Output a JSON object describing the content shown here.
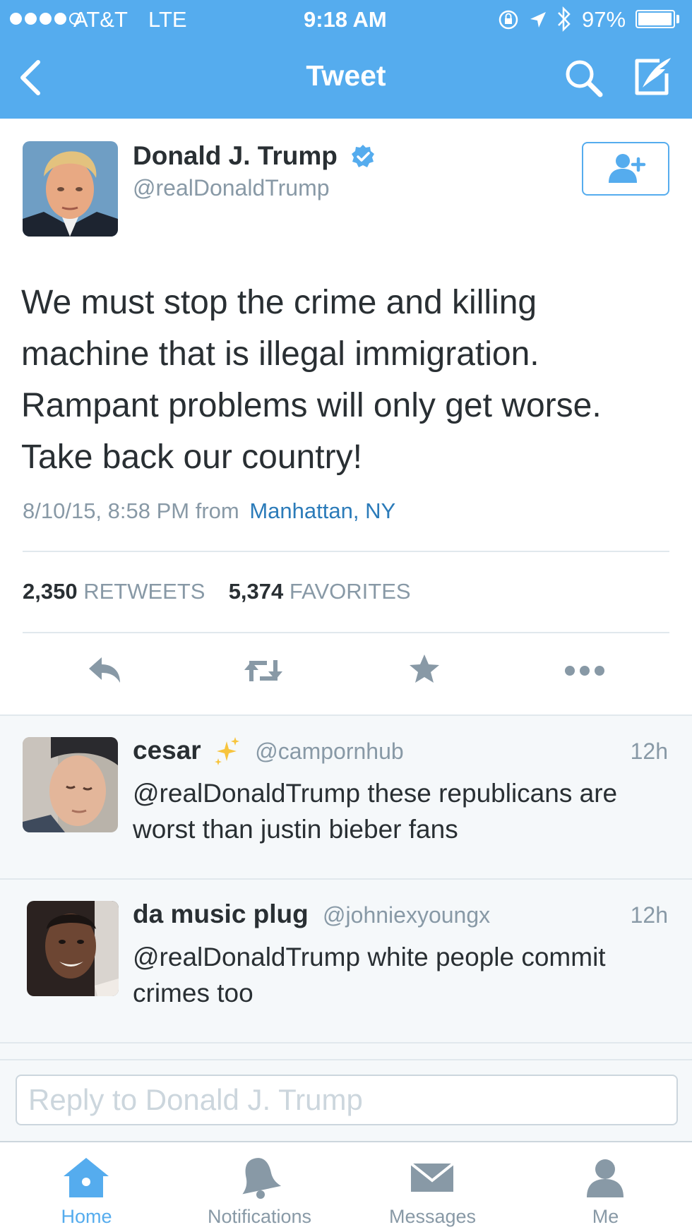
{
  "status_bar": {
    "carrier": "AT&T",
    "network": "LTE",
    "time": "9:18 AM",
    "battery": "97%",
    "battery_level": 0.97
  },
  "nav": {
    "title": "Tweet",
    "back_icon": "chevron-left-icon",
    "search_icon": "search-icon",
    "compose_icon": "compose-icon"
  },
  "tweet": {
    "author_name": "Donald J. Trump",
    "author_handle": "@realDonaldTrump",
    "verified": true,
    "text": "We must stop the crime and killing\nmachine that is illegal immigration.\nRampant problems will only get worse.\nTake back our country!",
    "timestamp": "8/10/15, 8:58 PM from",
    "location": "Manhattan, NY",
    "retweets_count": "2,350",
    "retweets_label": "RETWEETS",
    "favorites_count": "5,374",
    "favorites_label": "FAVORITES"
  },
  "replies": [
    {
      "name": "cesar",
      "handle": "@campornhub",
      "time": "12h",
      "text": "@realDonaldTrump these republicans are worst than justin bieber fans"
    },
    {
      "name": "da music plug",
      "handle": "@johniexyoungx",
      "time": "12h",
      "text": "@realDonaldTrump white people commit crimes too"
    }
  ],
  "reply_box": {
    "placeholder": "Reply to Donald J. Trump"
  },
  "tabs": [
    {
      "label": "Home",
      "icon": "home-icon",
      "active": true
    },
    {
      "label": "Notifications",
      "icon": "bell-icon",
      "active": false
    },
    {
      "label": "Messages",
      "icon": "envelope-icon",
      "active": false
    },
    {
      "label": "Me",
      "icon": "person-icon",
      "active": false
    }
  ],
  "colors": {
    "brand": "#55acee",
    "link": "#2b7bb9",
    "muted": "#8899a6",
    "text": "#292f33",
    "divider": "#e1e8ed"
  }
}
